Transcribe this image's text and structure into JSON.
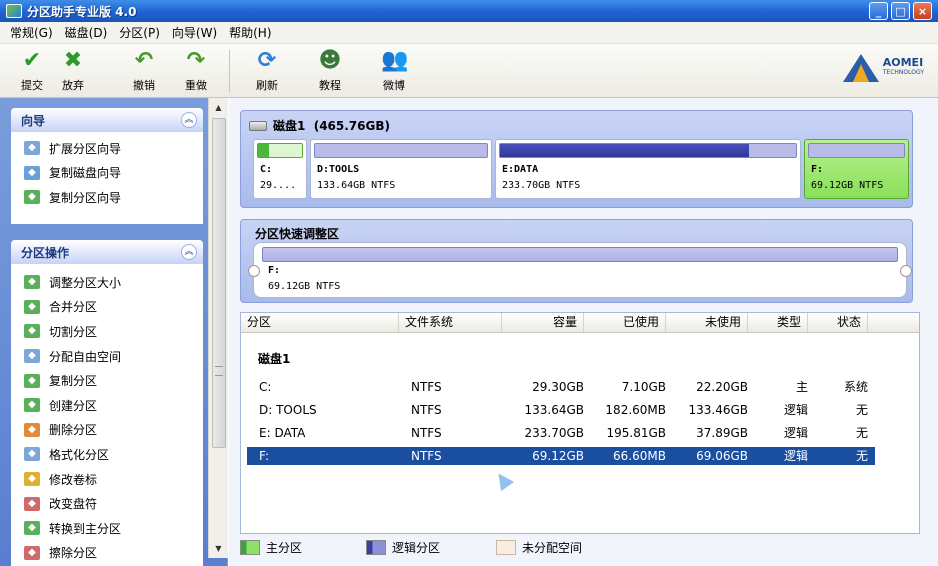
{
  "window": {
    "title": "分区助手专业版 4.0",
    "buttons": [
      "_",
      "□",
      "×"
    ]
  },
  "menu": [
    "常规(G)",
    "磁盘(D)",
    "分区(P)",
    "向导(W)",
    "帮助(H)"
  ],
  "toolbar": {
    "commit": "提交",
    "discard": "放弃",
    "undo": "撤销",
    "redo": "重做",
    "refresh": "刷新",
    "tutorial": "教程",
    "weibo": "微博"
  },
  "logo": {
    "name": "AOMEI",
    "sub": "TECHNOLOGY"
  },
  "wizard": {
    "title": "向导",
    "items": [
      "扩展分区向导",
      "复制磁盘向导",
      "复制分区向导"
    ]
  },
  "ops": {
    "title": "分区操作",
    "items": [
      "调整分区大小",
      "合并分区",
      "切割分区",
      "分配自由空间",
      "复制分区",
      "创建分区",
      "删除分区",
      "格式化分区",
      "修改卷标",
      "改变盘符",
      "转换到主分区",
      "擦除分区"
    ]
  },
  "disk": {
    "label": "磁盘1  (465.76GB)",
    "partitions": [
      {
        "label": "C:",
        "info": "29....",
        "fill": 0.25,
        "selected": false
      },
      {
        "label": "D:TOOLS",
        "info": "133.64GB NTFS",
        "fill": 0.0,
        "selected": false
      },
      {
        "label": "E:DATA",
        "info": "233.70GB NTFS",
        "fill": 0.84,
        "selected": false
      },
      {
        "label": "F:",
        "info": "69.12GB NTFS",
        "fill": 0.0,
        "selected": true
      }
    ]
  },
  "quick": {
    "title": "分区快速调整区",
    "label": "F:",
    "info": "69.12GB NTFS"
  },
  "table": {
    "columns": [
      "分区",
      "文件系统",
      "容量",
      "已使用",
      "未使用",
      "类型",
      "状态"
    ],
    "group": "磁盘1",
    "rows": [
      [
        "C:",
        "NTFS",
        "29.30GB",
        "7.10GB",
        "22.20GB",
        "主",
        "系统"
      ],
      [
        "D: TOOLS",
        "NTFS",
        "133.64GB",
        "182.60MB",
        "133.46GB",
        "逻辑",
        "无"
      ],
      [
        "E: DATA",
        "NTFS",
        "233.70GB",
        "195.81GB",
        "37.89GB",
        "逻辑",
        "无"
      ],
      [
        "F:",
        "NTFS",
        "69.12GB",
        "66.60MB",
        "69.06GB",
        "逻辑",
        "无"
      ]
    ],
    "selected_row": 3
  },
  "legend": {
    "primary": "主分区",
    "logical": "逻辑分区",
    "unallocated": "未分配空间"
  },
  "colors": {
    "primary": "#6fd24a",
    "logical": "#5b60c8",
    "unallocated": "#f8ede0",
    "selection": "#1a4fa0"
  }
}
